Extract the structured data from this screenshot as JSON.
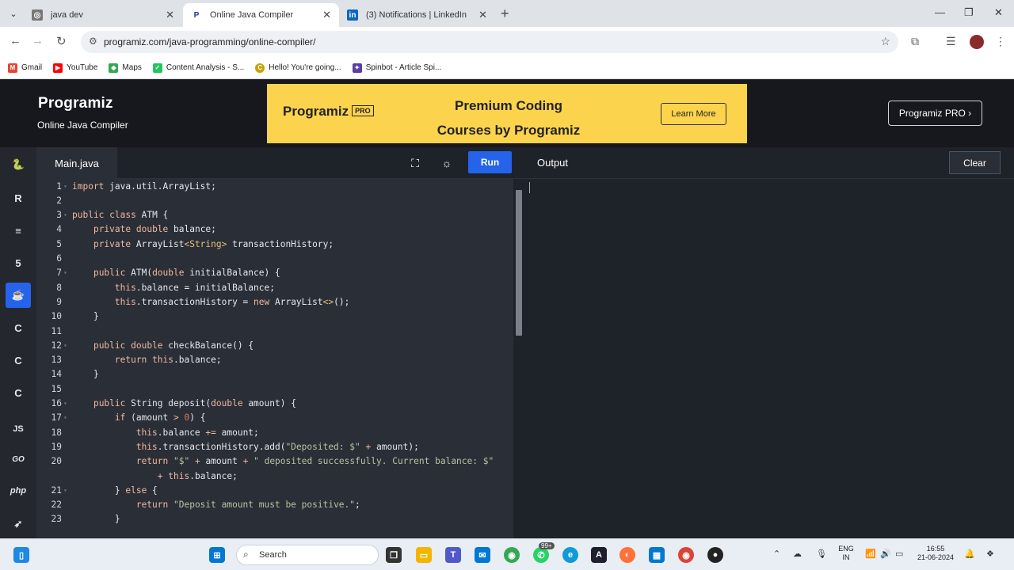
{
  "browser": {
    "tabs": [
      {
        "label": "java dev",
        "icon": "globe-icon",
        "color": "#555555"
      },
      {
        "label": "Online Java Compiler",
        "icon": "programiz-icon",
        "color": "#1e3a8a"
      },
      {
        "label": "(3) Notifications | LinkedIn",
        "icon": "linkedin-icon",
        "color": "#0a66c2"
      }
    ],
    "url": "programiz.com/java-programming/online-compiler/",
    "bookmarks": [
      {
        "label": "Gmail",
        "icon": "gmail-icon",
        "color": "#ea4335"
      },
      {
        "label": "YouTube",
        "icon": "youtube-icon",
        "color": "#ff0000"
      },
      {
        "label": "Maps",
        "icon": "maps-icon",
        "color": "#34a853"
      },
      {
        "label": "Content Analysis - S...",
        "icon": "check-icon",
        "color": "#22c55e"
      },
      {
        "label": "Hello! You're going...",
        "icon": "coin-icon",
        "color": "#c8a200"
      },
      {
        "label": "Spinbot - Article Spi...",
        "icon": "spinbot-icon",
        "color": "#5b3fa0"
      }
    ]
  },
  "header": {
    "logo": "Programiz",
    "subtitle": "Online Java Compiler",
    "banner": {
      "logo": "Programiz",
      "pro_tag": "PRO",
      "line1": "Premium Coding",
      "line2": "Courses by Programiz",
      "button": "Learn More"
    },
    "pro_button": "Programiz PRO ›"
  },
  "rail": [
    "python-icon",
    "r-icon",
    "sql-icon",
    "html-icon",
    "java-icon",
    "c-icon",
    "cpp-icon",
    "csharp-icon",
    "js-icon",
    "go-icon",
    "php-icon",
    "swift-icon"
  ],
  "rail_labels": {
    "js": "JS",
    "go": "GO",
    "php": "php"
  },
  "editor": {
    "file_tab": "Main.java",
    "run": "Run",
    "lines": [
      {
        "n": "1",
        "html": "<span class='kw'>import</span> java.util.ArrayList;"
      },
      {
        "n": "2",
        "html": ""
      },
      {
        "n": "3",
        "html": "<span class='kw'>public</span> <span class='kw'>class</span> ATM {"
      },
      {
        "n": "4",
        "html": "    <span class='kw'>private</span> <span class='kw'>double</span> balance;"
      },
      {
        "n": "5",
        "html": "    <span class='kw'>private</span> ArrayList<span class='ty'>&lt;String&gt;</span> transactionHistory;"
      },
      {
        "n": "6",
        "html": ""
      },
      {
        "n": "7",
        "html": "    <span class='kw'>public</span> ATM(<span class='kw'>double</span> initialBalance) {"
      },
      {
        "n": "8",
        "html": "        <span class='kw'>this</span>.balance = initialBalance;"
      },
      {
        "n": "9",
        "html": "        <span class='kw'>this</span>.transactionHistory = <span class='kw'>new</span> ArrayList<span class='ty'>&lt;&gt;</span>();"
      },
      {
        "n": "10",
        "html": "    }"
      },
      {
        "n": "11",
        "html": ""
      },
      {
        "n": "12",
        "html": "    <span class='kw'>public</span> <span class='kw'>double</span> checkBalance() {"
      },
      {
        "n": "13",
        "html": "        <span class='kw'>return</span> <span class='kw'>this</span>.balance;"
      },
      {
        "n": "14",
        "html": "    }"
      },
      {
        "n": "15",
        "html": ""
      },
      {
        "n": "16",
        "html": "    <span class='kw'>public</span> String deposit(<span class='kw'>double</span> amount) {"
      },
      {
        "n": "17",
        "html": "        <span class='kw'>if</span> (amount <span class='kw'>&gt;</span> <span class='num'>0</span>) {"
      },
      {
        "n": "18",
        "html": "            <span class='kw'>this</span>.balance <span class='kw'>+=</span> amount;"
      },
      {
        "n": "19",
        "html": "            <span class='kw'>this</span>.transactionHistory.add(<span class='str'>\"Deposited: $\"</span> <span class='kw'>+</span> amount);"
      },
      {
        "n": "20",
        "html": "            <span class='kw'>return</span> <span class='str'>\"$\"</span> <span class='kw'>+</span> amount <span class='kw'>+</span> <span class='str'>\" deposited successfully. Current balance: $\"</span>"
      },
      {
        "n": "",
        "html": "                <span class='kw'>+</span> <span class='kw'>this</span>.balance;"
      },
      {
        "n": "21",
        "html": "        } <span class='kw'>else</span> {"
      },
      {
        "n": "22",
        "html": "            <span class='kw'>return</span> <span class='str'>\"Deposit amount must be positive.\"</span>;"
      },
      {
        "n": "23",
        "html": "        }"
      }
    ],
    "fold_lines": [
      "1",
      "3",
      "7",
      "12",
      "16",
      "17",
      "21"
    ]
  },
  "output": {
    "title": "Output",
    "clear": "Clear"
  },
  "taskbar": {
    "search_placeholder": "Search",
    "lang_top": "ENG",
    "lang_bottom": "IN",
    "time": "16:55",
    "date": "21-06-2024",
    "badge": "99+"
  },
  "colors": {
    "accent": "#2563eb",
    "banner": "#fcd34d",
    "editor_bg": "#2a2e36",
    "page_bg": "#1e2229"
  }
}
